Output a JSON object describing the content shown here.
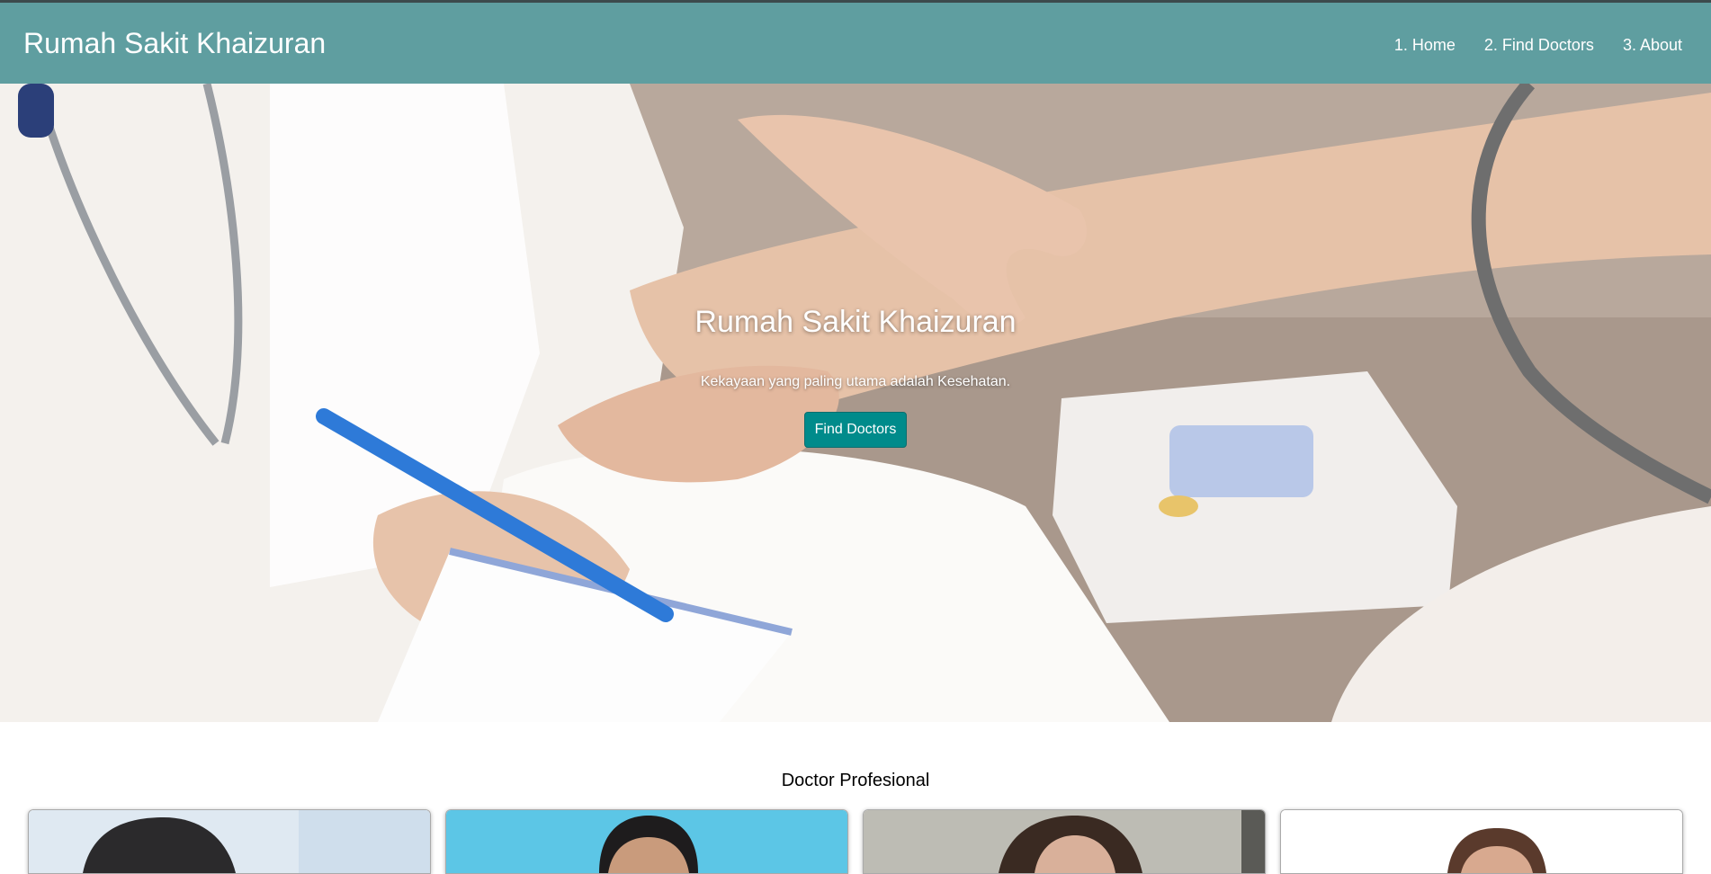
{
  "navbar": {
    "brand": "Rumah Sakit Khaizuran",
    "links": [
      "1. Home",
      "2. Find Doctors",
      "3. About"
    ]
  },
  "hero": {
    "title": "Rumah Sakit Khaizuran",
    "subtitle": "Kekayaan yang paling utama adalah Kesehatan.",
    "button_label": "Find Doctors"
  },
  "doctors_section": {
    "title": "Doctor Profesional"
  },
  "colors": {
    "navbar": "#5f9ea0",
    "button": "#008b8b"
  }
}
